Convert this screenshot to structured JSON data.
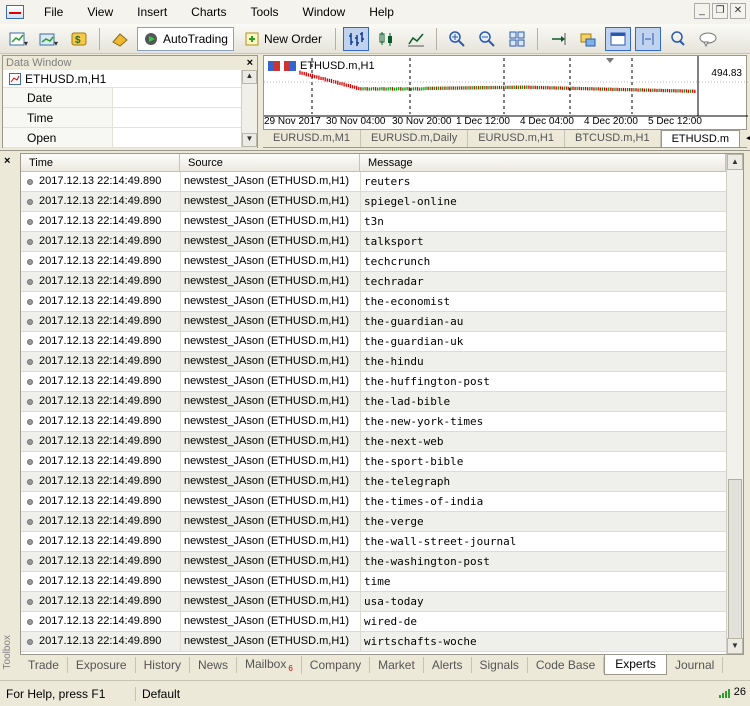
{
  "menu": [
    "File",
    "View",
    "Insert",
    "Charts",
    "Tools",
    "Window",
    "Help"
  ],
  "toolbar": {
    "autotrading_label": "AutoTrading",
    "new_order_label": "New Order"
  },
  "data_window": {
    "title": "Data Window",
    "symbol": "ETHUSD.m,H1",
    "rows": [
      {
        "label": "Date",
        "value": ""
      },
      {
        "label": "Time",
        "value": ""
      },
      {
        "label": "Open",
        "value": ""
      }
    ]
  },
  "chart": {
    "symbol_label": "ETHUSD.m,H1",
    "price_label": "494.83",
    "time_ticks": [
      "29 Nov 2017",
      "30 Nov 04:00",
      "30 Nov 20:00",
      "1 Dec 12:00",
      "4 Dec 04:00",
      "4 Dec 20:00",
      "5 Dec 12:00"
    ],
    "up_color": "#00a000",
    "down_color": "#d00000"
  },
  "chart_tabs": [
    "EURUSD.m,M1",
    "EURUSD.m,Daily",
    "EURUSD.m,H1",
    "BTCUSD.m,H1",
    "ETHUSD.m"
  ],
  "chart_tab_active": "ETHUSD.m",
  "toolbox": {
    "vertical_label": "Toolbox",
    "columns": [
      "Time",
      "Source",
      "Message"
    ],
    "rows": [
      {
        "time": "2017.12.13 22:14:49.890",
        "source": "newstest_JAson (ETHUSD.m,H1)",
        "message": "reuters"
      },
      {
        "time": "2017.12.13 22:14:49.890",
        "source": "newstest_JAson (ETHUSD.m,H1)",
        "message": "spiegel-online"
      },
      {
        "time": "2017.12.13 22:14:49.890",
        "source": "newstest_JAson (ETHUSD.m,H1)",
        "message": "t3n"
      },
      {
        "time": "2017.12.13 22:14:49.890",
        "source": "newstest_JAson (ETHUSD.m,H1)",
        "message": "talksport"
      },
      {
        "time": "2017.12.13 22:14:49.890",
        "source": "newstest_JAson (ETHUSD.m,H1)",
        "message": "techcrunch"
      },
      {
        "time": "2017.12.13 22:14:49.890",
        "source": "newstest_JAson (ETHUSD.m,H1)",
        "message": "techradar"
      },
      {
        "time": "2017.12.13 22:14:49.890",
        "source": "newstest_JAson (ETHUSD.m,H1)",
        "message": "the-economist"
      },
      {
        "time": "2017.12.13 22:14:49.890",
        "source": "newstest_JAson (ETHUSD.m,H1)",
        "message": "the-guardian-au"
      },
      {
        "time": "2017.12.13 22:14:49.890",
        "source": "newstest_JAson (ETHUSD.m,H1)",
        "message": "the-guardian-uk"
      },
      {
        "time": "2017.12.13 22:14:49.890",
        "source": "newstest_JAson (ETHUSD.m,H1)",
        "message": "the-hindu"
      },
      {
        "time": "2017.12.13 22:14:49.890",
        "source": "newstest_JAson (ETHUSD.m,H1)",
        "message": "the-huffington-post"
      },
      {
        "time": "2017.12.13 22:14:49.890",
        "source": "newstest_JAson (ETHUSD.m,H1)",
        "message": "the-lad-bible"
      },
      {
        "time": "2017.12.13 22:14:49.890",
        "source": "newstest_JAson (ETHUSD.m,H1)",
        "message": "the-new-york-times"
      },
      {
        "time": "2017.12.13 22:14:49.890",
        "source": "newstest_JAson (ETHUSD.m,H1)",
        "message": "the-next-web"
      },
      {
        "time": "2017.12.13 22:14:49.890",
        "source": "newstest_JAson (ETHUSD.m,H1)",
        "message": "the-sport-bible"
      },
      {
        "time": "2017.12.13 22:14:49.890",
        "source": "newstest_JAson (ETHUSD.m,H1)",
        "message": "the-telegraph"
      },
      {
        "time": "2017.12.13 22:14:49.890",
        "source": "newstest_JAson (ETHUSD.m,H1)",
        "message": "the-times-of-india"
      },
      {
        "time": "2017.12.13 22:14:49.890",
        "source": "newstest_JAson (ETHUSD.m,H1)",
        "message": "the-verge"
      },
      {
        "time": "2017.12.13 22:14:49.890",
        "source": "newstest_JAson (ETHUSD.m,H1)",
        "message": "the-wall-street-journal"
      },
      {
        "time": "2017.12.13 22:14:49.890",
        "source": "newstest_JAson (ETHUSD.m,H1)",
        "message": "the-washington-post"
      },
      {
        "time": "2017.12.13 22:14:49.890",
        "source": "newstest_JAson (ETHUSD.m,H1)",
        "message": "time"
      },
      {
        "time": "2017.12.13 22:14:49.890",
        "source": "newstest_JAson (ETHUSD.m,H1)",
        "message": "usa-today"
      },
      {
        "time": "2017.12.13 22:14:49.890",
        "source": "newstest_JAson (ETHUSD.m,H1)",
        "message": "wired-de"
      },
      {
        "time": "2017.12.13 22:14:49.890",
        "source": "newstest_JAson (ETHUSD.m,H1)",
        "message": "wirtschafts-woche"
      }
    ],
    "tabs": [
      {
        "label": "Trade"
      },
      {
        "label": "Exposure"
      },
      {
        "label": "History"
      },
      {
        "label": "News"
      },
      {
        "label": "Mailbox",
        "badge": "6"
      },
      {
        "label": "Company"
      },
      {
        "label": "Market"
      },
      {
        "label": "Alerts"
      },
      {
        "label": "Signals"
      },
      {
        "label": "Code Base"
      },
      {
        "label": "Experts"
      },
      {
        "label": "Journal"
      }
    ],
    "active_tab": "Experts"
  },
  "status": {
    "help": "For Help, press F1",
    "profile": "Default",
    "connection": "26"
  }
}
